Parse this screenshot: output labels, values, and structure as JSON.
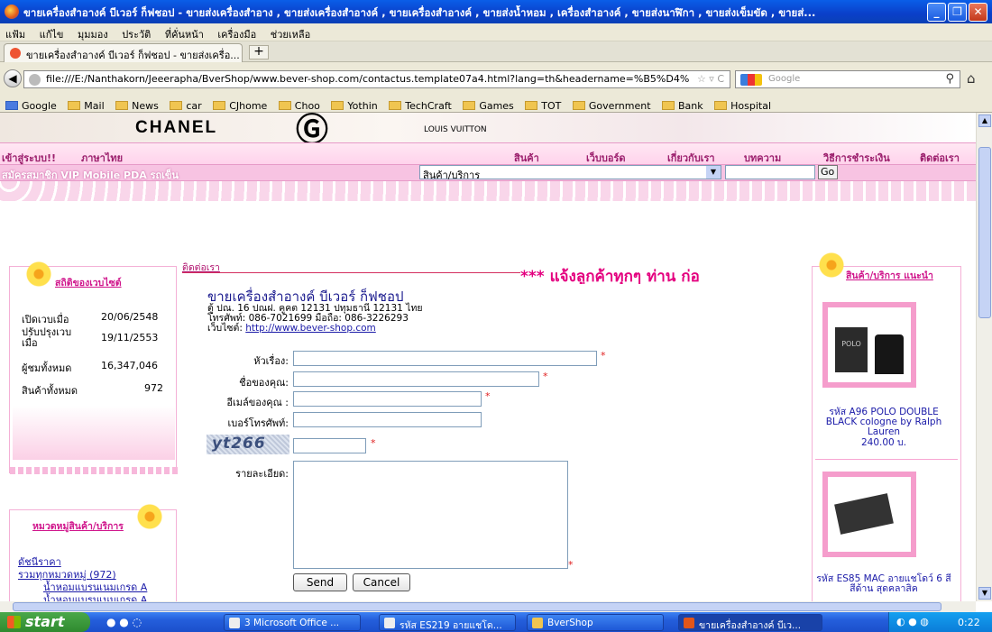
{
  "window": {
    "title": "ขายเครื่องสำอางค์ บีเวอร์ ก็ฟชอป - ขายส่งเครื่องสำอาง , ขายส่งเครื่องสำอางค์ , ขายเครื่องสำอางค์ , ขายส่งน้ำหอม , เครื่องสำอางค์ , ขายส่งนาฬิกา , ขายส่งเข็มขัด , ขายส่...",
    "minimize": "_",
    "maximize": "❐",
    "close": "✕"
  },
  "menu": [
    "แฟ้ม",
    "แก้ไข",
    "มุมมอง",
    "ประวัติ",
    "ที่คั่นหน้า",
    "เครื่องมือ",
    "ช่วยเหลือ"
  ],
  "tab": {
    "label": "ขายเครื่องสำอางค์ บีเวอร์ ก็ฟชอป - ขายส่งเครื่อ...",
    "new": "+"
  },
  "address": {
    "url": "file:///E:/Nanthakorn/Jeeerapha/BverShop/www.bever-shop.com/contactus.template07a4.html?lang=th&headername=%B5%D4%",
    "search_placeholder": "Google"
  },
  "bookmarks": [
    "Google",
    "Mail",
    "News",
    "car",
    "CJhome",
    "Choo",
    "Yothin",
    "TechCraft",
    "Games",
    "TOT",
    "Government",
    "Bank",
    "Hospital"
  ],
  "banner": {
    "brand1": "CHANEL",
    "brand2": "LOUIS VUITTON"
  },
  "site_nav": {
    "login": "เข้าสู่ระบบ!!",
    "language": "ภาษาไทย",
    "items": [
      "สินค้า",
      "เว็บบอร์ด",
      "เกี่ยวกับเรา",
      "บทความ",
      "วิธีการชำระเงิน",
      "ติดต่อเรา"
    ],
    "sub": "สมัครสมาชิก  VIP  Mobile  PDA  รถเข็น",
    "category_select": "สินค้า/บริการ",
    "go": "Go"
  },
  "stats": {
    "heading": "สถิติของเวบไซต์",
    "rows": [
      {
        "label": "เปิดเวบเมื่อ",
        "value": "20/06/2548"
      },
      {
        "label": "ปรับปรุงเวบเมื่อ",
        "value": "19/11/2553"
      },
      {
        "label": "ผู้ชมทั้งหมด",
        "value": "16,347,046"
      },
      {
        "label": "สินค้าทั้งหมด",
        "value": "972"
      }
    ]
  },
  "categories": {
    "heading": "หมวดหมู่สินค้า/บริการ",
    "items": [
      "ดัชนีราคา",
      "รวมทุกหมวดหมู่ (972)",
      "น้ำหอมแบรนเนมเกรด A",
      "น้ำหอมแบรนเนมเกรด A"
    ]
  },
  "contact": {
    "breadcrumb": "ติดต่อเรา",
    "marquee": "*** แจ้งลูกค้าทุกๆ ท่าน ก่อ",
    "shop_name": "ขายเครื่องสำอางค์ บีเวอร์ ก็ฟชอป",
    "address": "ตู้ ปณ. 16 ปณฝ. คูคต 12131 ปทุมธานี 12131 ไทย",
    "phone": "โทรศัพท์: 086-7021699 มือถือ: 086-3226293",
    "website_label": "เว็บไซต์:",
    "website": "http://www.bever-shop.com"
  },
  "form": {
    "subject": "หัวเรื่อง:",
    "name": "ชื่อของคุณ:",
    "email": "อีเมล์ของคุณ :",
    "phone": "เบอร์โทรศัพท์:",
    "captcha": "yt266",
    "detail": "รายละเอียด:",
    "required": "*",
    "send": "Send",
    "cancel": "Cancel"
  },
  "recommended": {
    "heading": "สินค้า/บริการ แนะนำ",
    "products": [
      {
        "name": "รหัส A96 POLO DOUBLE BLACK cologne by Ralph Lauren",
        "price": "240.00 บ.",
        "img_text": "POLO"
      },
      {
        "name": "รหัส ES85 MAC อายแชโดว์ 6 สี สีด้าน สุดคลาสิค",
        "price": ""
      }
    ]
  },
  "taskbar": {
    "start": "start",
    "items": [
      "3 Microsoft Office ...",
      "รหัส ES219 อายแชโด...",
      "BverShop",
      "ขายเครื่องสำอางค์ บีเว..."
    ],
    "clock": "0:22"
  }
}
